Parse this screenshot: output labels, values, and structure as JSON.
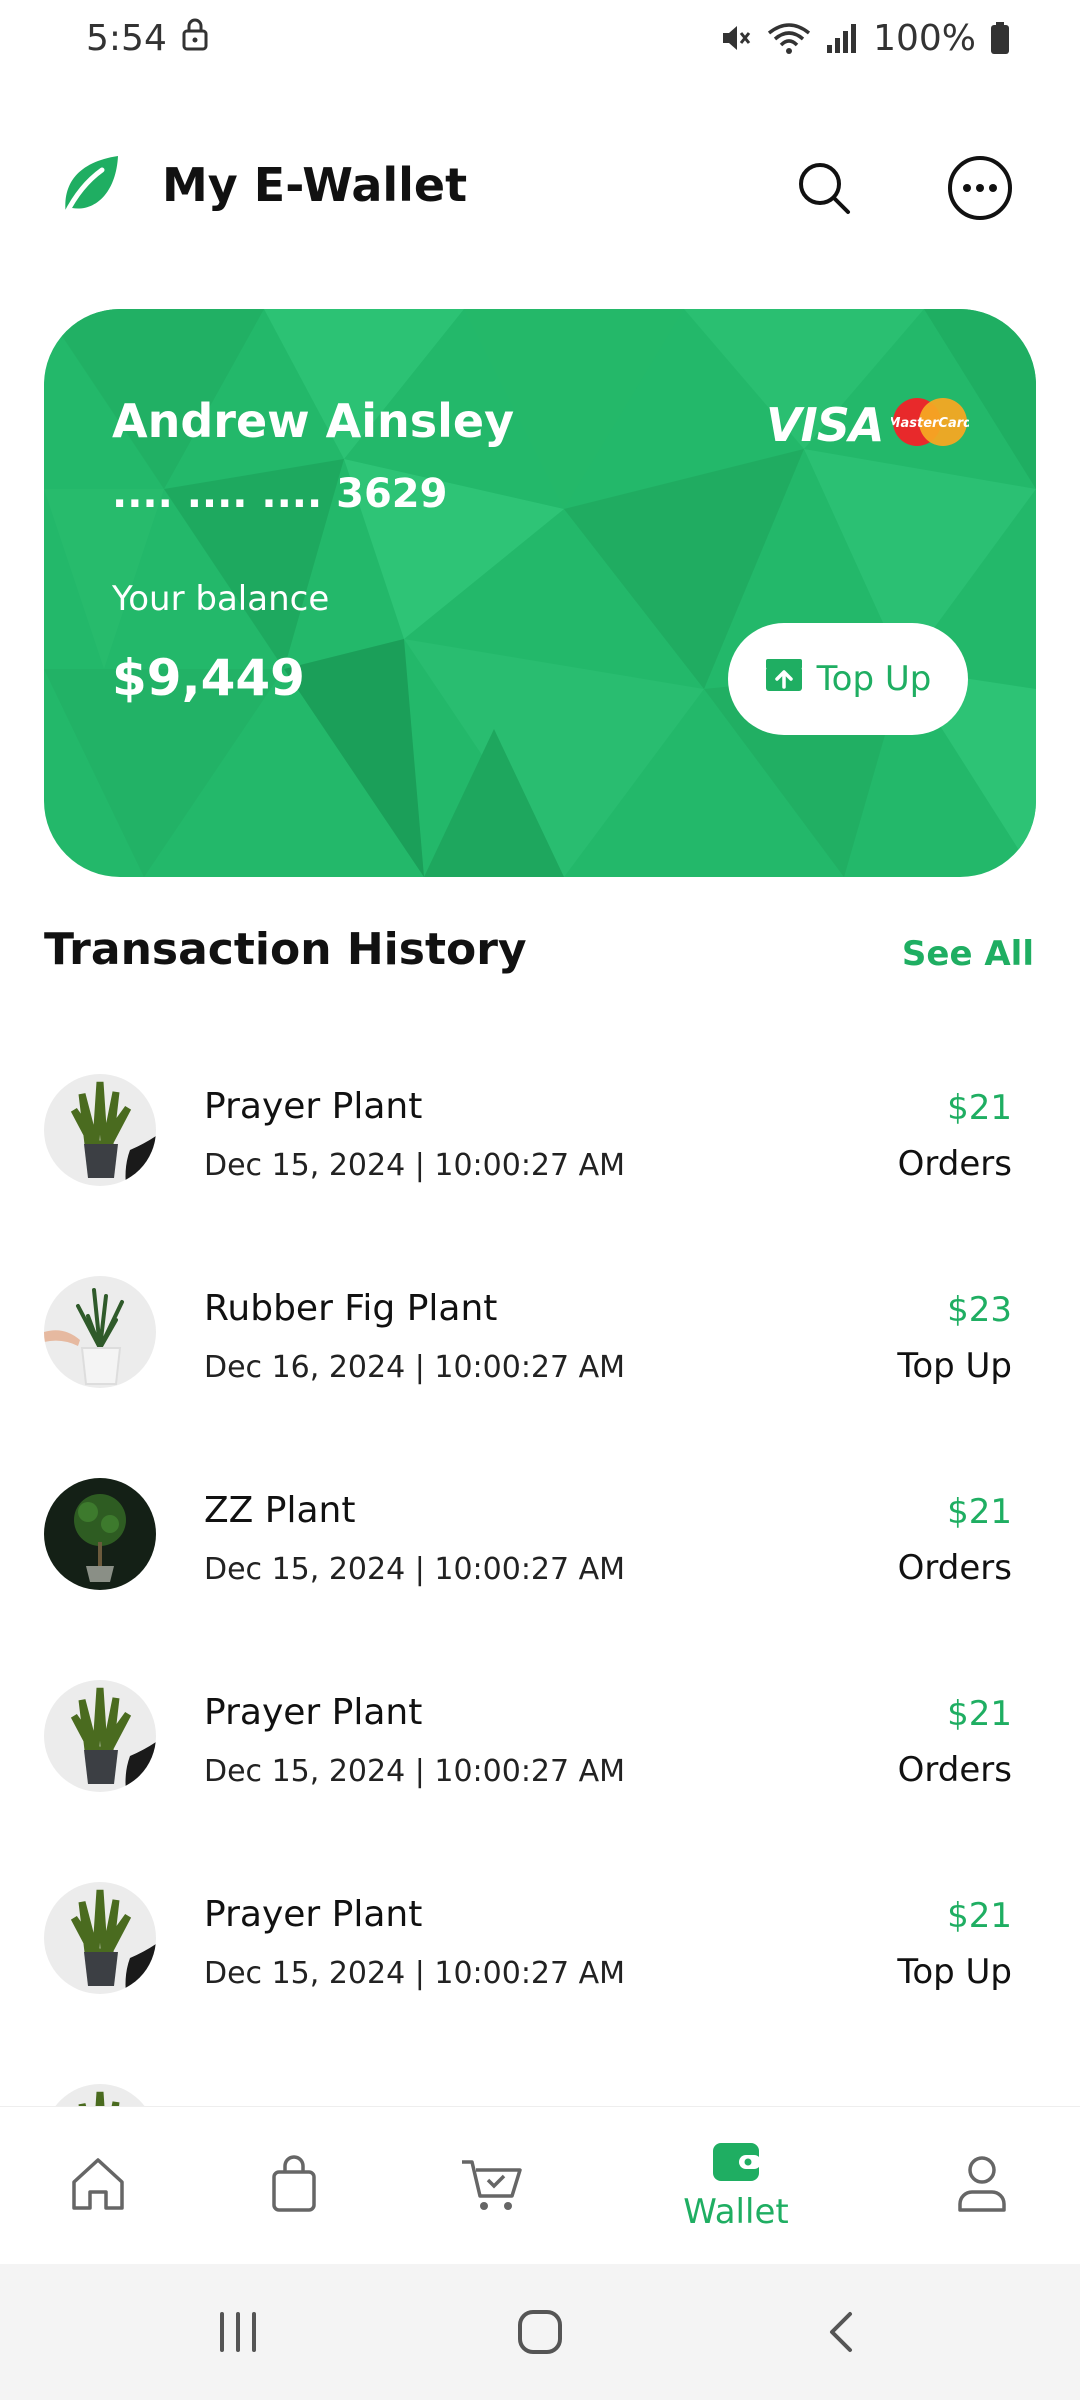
{
  "status_bar": {
    "time": "5:54",
    "battery": "100%",
    "icons": [
      "lock-icon",
      "mute-icon",
      "wifi-icon",
      "signal-icon",
      "battery-icon"
    ]
  },
  "header": {
    "title": "My E-Wallet",
    "icons": [
      "leaf-logo-icon",
      "search-icon",
      "more-icon"
    ]
  },
  "card": {
    "holder_name": "Andrew Ainsley",
    "masked_number": ".... .... .... 3629",
    "balance_label": "Your balance",
    "balance": "$9,449",
    "brand_visa": "VISA",
    "brand_mastercard": "MasterCard",
    "topup_label": "Top Up",
    "colors": {
      "card": "#23b86a",
      "accent": "#1fae62"
    }
  },
  "transactions": {
    "title": "Transaction History",
    "see_all": "See All",
    "items": [
      {
        "name": "Prayer Plant",
        "date": "Dec 15, 2024 | 10:00:27 AM",
        "amount": "$21",
        "type": "Orders"
      },
      {
        "name": "Rubber Fig Plant",
        "date": "Dec 16, 2024 | 10:00:27 AM",
        "amount": "$23",
        "type": "Top Up"
      },
      {
        "name": "ZZ Plant",
        "date": "Dec 15, 2024 | 10:00:27 AM",
        "amount": "$21",
        "type": "Orders"
      },
      {
        "name": "Prayer Plant",
        "date": "Dec 15, 2024 | 10:00:27 AM",
        "amount": "$21",
        "type": "Orders"
      },
      {
        "name": "Prayer Plant",
        "date": "Dec 15, 2024 | 10:00:27 AM",
        "amount": "$21",
        "type": "Top Up"
      }
    ]
  },
  "bottom_nav": {
    "items": [
      "home-icon",
      "bag-icon",
      "cart-icon",
      "wallet-icon",
      "profile-icon"
    ],
    "active_label": "Wallet"
  },
  "system_nav": {
    "icons": [
      "recents-icon",
      "home-circle-icon",
      "back-icon"
    ]
  }
}
